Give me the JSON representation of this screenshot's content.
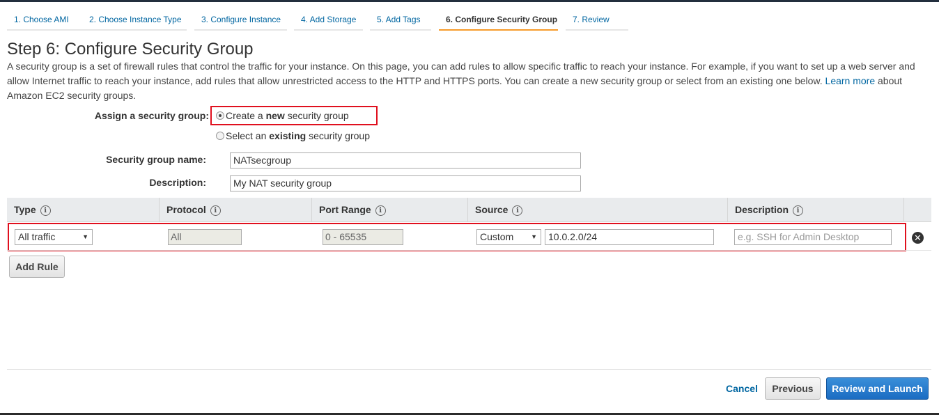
{
  "wizard": {
    "tabs": [
      {
        "label": "1. Choose AMI"
      },
      {
        "label": "2. Choose Instance Type"
      },
      {
        "label": "3. Configure Instance"
      },
      {
        "label": "4. Add Storage"
      },
      {
        "label": "5. Add Tags"
      },
      {
        "label": "6. Configure Security Group",
        "active": true
      },
      {
        "label": "7. Review"
      }
    ]
  },
  "page": {
    "title": "Step 6: Configure Security Group",
    "intro_text": "A security group is a set of firewall rules that control the traffic for your instance. On this page, you can add rules to allow specific traffic to reach your instance. For example, if you want to set up a web server and allow Internet traffic to reach your instance, add rules that allow unrestricted access to the HTTP and HTTPS ports. You can create a new security group or select from an existing one below.",
    "learn_more": "Learn more",
    "intro_suffix": "about Amazon EC2 security groups."
  },
  "assign": {
    "label": "Assign a security group:",
    "option_new_prefix": "Create a",
    "option_new_bold": "new",
    "option_new_suffix": "security group",
    "option_existing_prefix": "Select an",
    "option_existing_bold": "existing",
    "option_existing_suffix": "security group",
    "selected": "new"
  },
  "form": {
    "name_label": "Security group name:",
    "name_value": "NATsecgroup",
    "desc_label": "Description:",
    "desc_value": "My NAT security group"
  },
  "rules_table": {
    "columns": [
      "Type",
      "Protocol",
      "Port Range",
      "Source",
      "Description"
    ],
    "rows": [
      {
        "type": "All traffic",
        "protocol": "All",
        "port_range": "0 - 65535",
        "source_type": "Custom",
        "source_value": "10.0.2.0/24",
        "description_placeholder": "e.g. SSH for Admin Desktop"
      }
    ],
    "add_rule_label": "Add Rule"
  },
  "footer": {
    "cancel_label": "Cancel",
    "previous_label": "Previous",
    "review_launch_label": "Review and Launch"
  },
  "colors": {
    "link": "#0066a1",
    "active_tab_underline": "#f79a2a",
    "highlight_box": "#e0101e",
    "primary_button": "#1b6cc2"
  }
}
